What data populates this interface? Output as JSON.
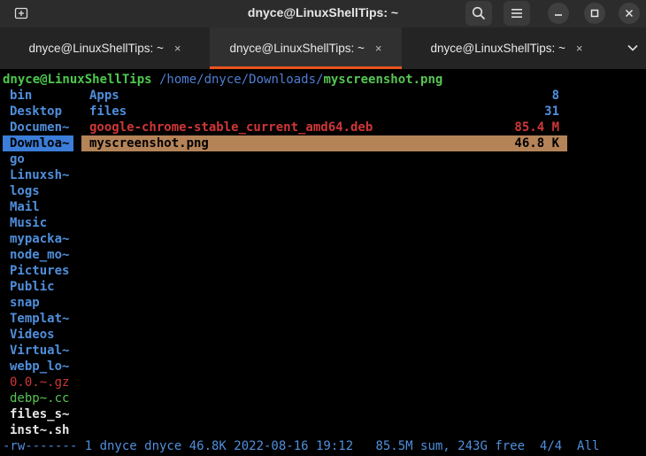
{
  "window": {
    "title": "dnyce@LinuxShellTips: ~",
    "icons": {
      "new_tab": "new-tab-icon",
      "search": "search-icon",
      "menu": "hamburger-menu-icon",
      "minimize": "minimize-icon",
      "maximize": "maximize-icon",
      "close": "close-icon",
      "tab_list": "chevron-down-icon"
    }
  },
  "tabs": [
    {
      "label": "dnyce@LinuxShellTips: ~",
      "close": "×",
      "active": false
    },
    {
      "label": "dnyce@LinuxShellTips: ~",
      "close": "×",
      "active": true
    },
    {
      "label": "dnyce@LinuxShellTips: ~",
      "close": "×",
      "active": false
    }
  ],
  "terminal": {
    "prompt": {
      "user_host": "dnyce@LinuxShellTips",
      "path": " /home/dnyce/Downloads/",
      "file": "myscreenshot.png"
    },
    "parent_dir": [
      {
        "name": "bin",
        "kind": "dir"
      },
      {
        "name": "Desktop",
        "kind": "dir"
      },
      {
        "name": "Documen~",
        "kind": "dir"
      },
      {
        "name": "Downloa~",
        "kind": "dir",
        "selected": true
      },
      {
        "name": "go",
        "kind": "dir"
      },
      {
        "name": "Linuxsh~",
        "kind": "dir"
      },
      {
        "name": "logs",
        "kind": "dir"
      },
      {
        "name": "Mail",
        "kind": "dir"
      },
      {
        "name": "Music",
        "kind": "dir"
      },
      {
        "name": "mypacka~",
        "kind": "dir"
      },
      {
        "name": "node_mo~",
        "kind": "dir"
      },
      {
        "name": "Pictures",
        "kind": "dir"
      },
      {
        "name": "Public",
        "kind": "dir"
      },
      {
        "name": "snap",
        "kind": "dir"
      },
      {
        "name": "Templat~",
        "kind": "dir"
      },
      {
        "name": "Videos",
        "kind": "dir"
      },
      {
        "name": "Virtual~",
        "kind": "dir"
      },
      {
        "name": "webp_lo~",
        "kind": "dir"
      },
      {
        "name": "0.0.~.gz",
        "kind": "archive"
      },
      {
        "name": "debp~.cc",
        "kind": "source"
      },
      {
        "name": "files_s~",
        "kind": "file"
      },
      {
        "name": "inst~.sh",
        "kind": "script"
      }
    ],
    "current_dir": [
      {
        "name": "Apps",
        "size": "8",
        "kind": "dir"
      },
      {
        "name": "files",
        "size": "31",
        "kind": "dir"
      },
      {
        "name": "google-chrome-stable_current_amd64.deb",
        "size": "85.4 M",
        "kind": "archive"
      },
      {
        "name": "myscreenshot.png",
        "size": "46.8 K",
        "kind": "image",
        "selected": true
      }
    ],
    "status": {
      "left": "-rw------- 1 dnyce dnyce 46.8K 2022-08-16 19:12",
      "right": "85.5M sum, 243G free  4/4  All"
    }
  },
  "colors": {
    "accent": "#e95420",
    "dir": "#4f8fdc",
    "archive": "#cf3737",
    "source": "#57c553",
    "highlight": "#b58358",
    "parent_highlight": "#3b7dd8"
  }
}
